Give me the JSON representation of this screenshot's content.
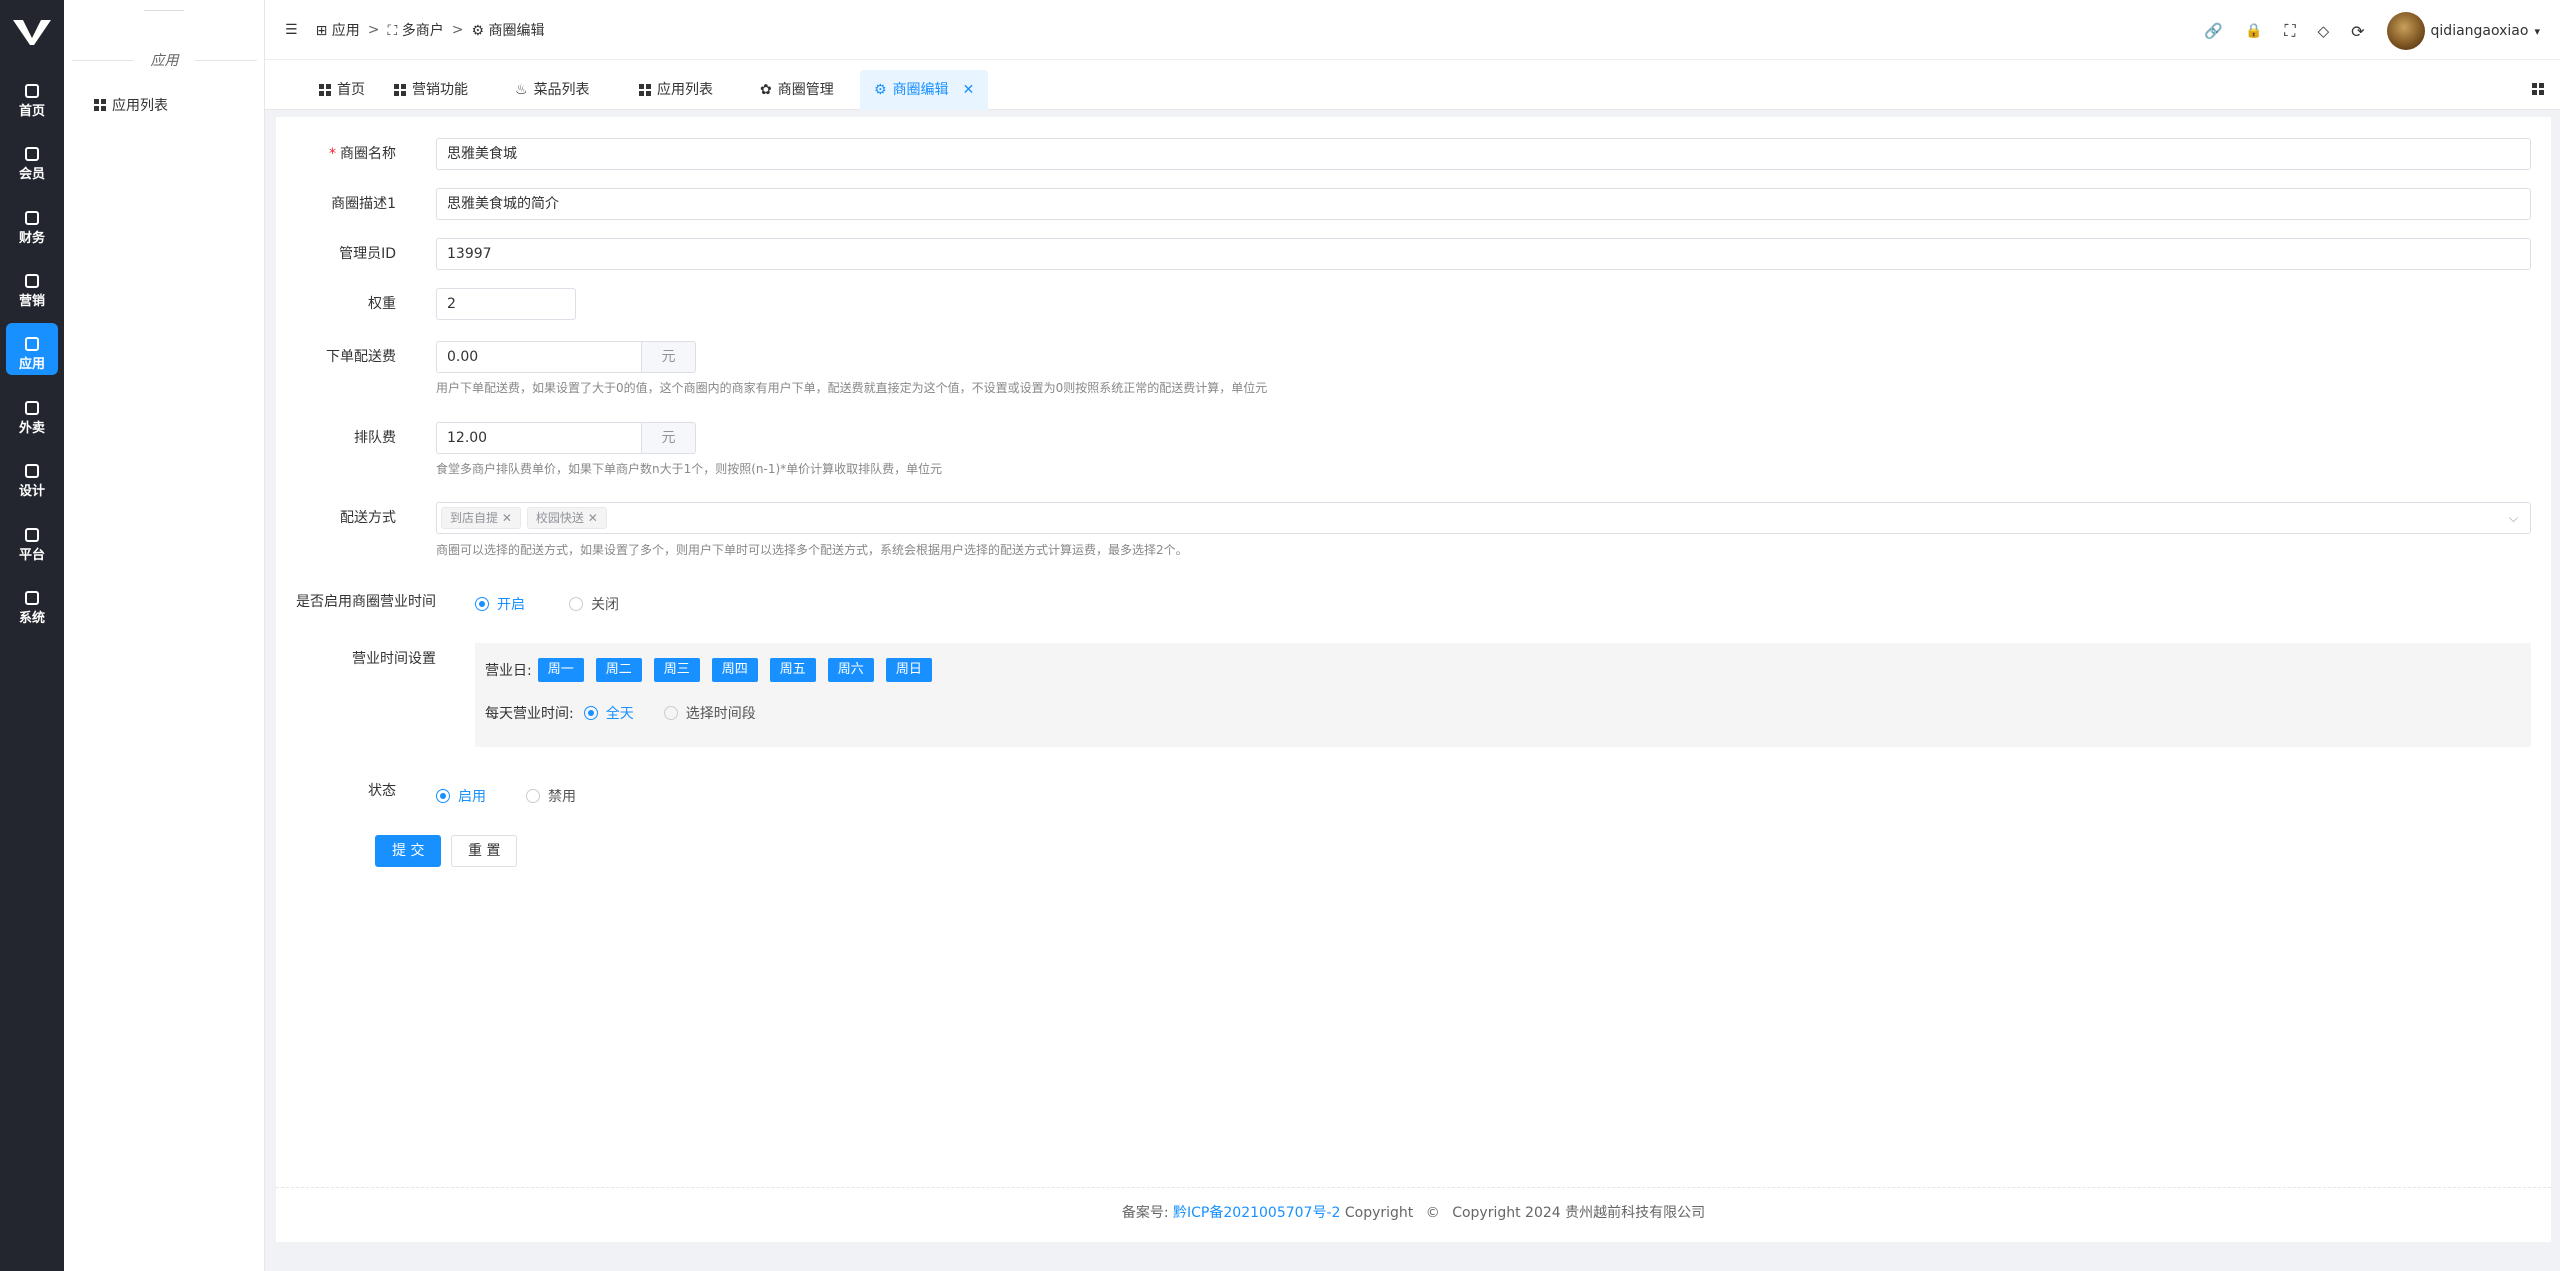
{
  "rail": {
    "items": [
      {
        "label": "首页",
        "icon": "home-icon"
      },
      {
        "label": "会员",
        "icon": "member-icon"
      },
      {
        "label": "财务",
        "icon": "finance-icon"
      },
      {
        "label": "营销",
        "icon": "marketing-icon"
      },
      {
        "label": "应用",
        "icon": "app-icon",
        "active": true
      },
      {
        "label": "外卖",
        "icon": "takeout-icon"
      },
      {
        "label": "设计",
        "icon": "design-icon"
      },
      {
        "label": "平台",
        "icon": "platform-icon"
      },
      {
        "label": "系统",
        "icon": "system-icon"
      }
    ]
  },
  "sidebar": {
    "section_title": "应用",
    "menu_item": "应用列表"
  },
  "header": {
    "breadcrumb": [
      "应用",
      "多商户",
      "商圈编辑"
    ],
    "username": "qidiangaoxiao"
  },
  "tabs": [
    {
      "label": "首页"
    },
    {
      "label": "营销功能"
    },
    {
      "label": "菜品列表"
    },
    {
      "label": "应用列表"
    },
    {
      "label": "商圈管理"
    },
    {
      "label": "商圈编辑",
      "active": true
    }
  ],
  "form": {
    "name_label": "商圈名称",
    "name_value": "思雅美食城",
    "desc_label": "商圈描述1",
    "desc_value": "思雅美食城的简介",
    "admin_label": "管理员ID",
    "admin_value": "13997",
    "weight_label": "权重",
    "weight_value": "2",
    "delivery_label": "下单配送费",
    "delivery_value": "0.00",
    "delivery_unit": "元",
    "delivery_help": "用户下单配送费，如果设置了大于0的值，这个商圈内的商家有用户下单，配送费就直接定为这个值，不设置或设置为0则按照系统正常的配送费计算，单位元",
    "queue_label": "排队费",
    "queue_value": "12.00",
    "queue_unit": "元",
    "queue_help": "食堂多商户排队费单价，如果下单商户数n大于1个，则按照(n-1)*单价计算收取排队费，单位元",
    "method_label": "配送方式",
    "method_tags": [
      "到店自提",
      "校园快送"
    ],
    "method_help": "商圈可以选择的配送方式，如果设置了多个，则用户下单时可以选择多个配送方式，系统会根据用户选择的配送方式计算运费，最多选择2个。",
    "hours_enable_label": "是否启用商圈营业时间",
    "hours_enable_on": "开启",
    "hours_enable_off": "关闭",
    "hours_set_label": "营业时间设置",
    "business_days_label": "营业日:",
    "days": [
      "周一",
      "周二",
      "周三",
      "周四",
      "周五",
      "周六",
      "周日"
    ],
    "daily_label": "每天营业时间:",
    "daily_all": "全天",
    "daily_range": "选择时间段",
    "status_label": "状态",
    "status_on": "启用",
    "status_off": "禁用",
    "submit": "提 交",
    "reset": "重 置"
  },
  "footer": {
    "record_prefix": "备案号:",
    "record_link": "黔ICP备2021005707号-2",
    "copyright_word": "Copyright",
    "copyright_text": "Copyright 2024 贵州越前科技有限公司"
  },
  "colors": {
    "accent": "#1890ff",
    "rail_bg": "#23262e"
  }
}
